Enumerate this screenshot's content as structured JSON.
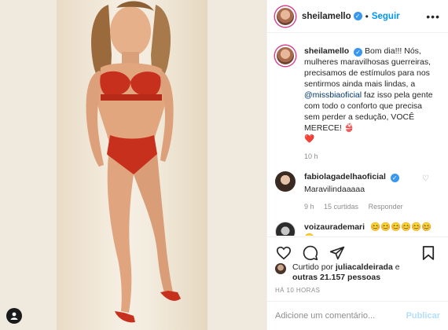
{
  "post": {
    "author": "sheilamello",
    "follow_label": "Seguir",
    "separator": "•",
    "more_icon": "more-horizontal-icon"
  },
  "caption": {
    "author": "sheilamello",
    "text_before_mention": "Bom dia!!! Nós, mulheres maravilhosas guerreiras, precisamos de estímulos para nos sentirmos ainda mais lindas, a ",
    "mention": "@missbiaoficial",
    "text_after_mention": " faz isso pela gente com todo o conforto que precisa sem perder a sedução, VOCÊ MERECE! 👙",
    "emoji_line": "❤️",
    "time": "10 h"
  },
  "comments": [
    {
      "author": "fabiolagadelhaoficial",
      "text": "Maravilindaaaaa",
      "time": "9 h",
      "likes": "15 curtidas",
      "reply_label": "Responder"
    },
    {
      "author": "voizaurademari",
      "text": "😊😊😊😊😊😊😊"
    }
  ],
  "likes": {
    "prefix": "Curtido por ",
    "user": "juliacaldeirada",
    "middle": " e",
    "others": "outras 21.157 pessoas"
  },
  "posted_time": "HÁ 10 HORAS",
  "comment_input": {
    "placeholder": "Adicione um comentário...",
    "publish_label": "Publicar"
  },
  "colors": {
    "link_blue": "#0095f6",
    "verified_blue": "#3897f0",
    "heart_red": "#ed4956",
    "muted": "#8e8e8e"
  }
}
